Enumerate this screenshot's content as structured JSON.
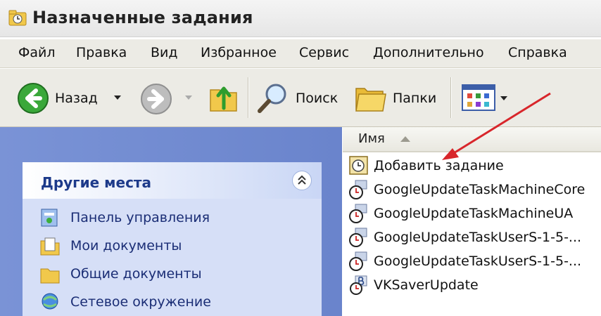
{
  "window": {
    "title": "Назначенные задания",
    "title_icon": "folder-clock-icon"
  },
  "menu": [
    "Файл",
    "Правка",
    "Вид",
    "Избранное",
    "Сервис",
    "Дополнительно",
    "Справка"
  ],
  "toolbar": {
    "back_label": "Назад",
    "search_label": "Поиск",
    "folders_label": "Папки"
  },
  "left_panel": {
    "title": "Другие места",
    "items": [
      "Панель управления",
      "Мои документы",
      "Общие документы",
      "Сетевое окружение"
    ]
  },
  "list": {
    "column_name": "Имя",
    "items": [
      "Добавить задание",
      "GoogleUpdateTaskMachineCore",
      "GoogleUpdateTaskMachineUA",
      "GoogleUpdateTaskUserS-1-5-...",
      "GoogleUpdateTaskUserS-1-5-...",
      "VKSaverUpdate"
    ]
  },
  "colors": {
    "annotation_arrow": "#d8262b",
    "panel_title": "#1d3a8a",
    "left_pane_bg": "#7a93d6"
  }
}
